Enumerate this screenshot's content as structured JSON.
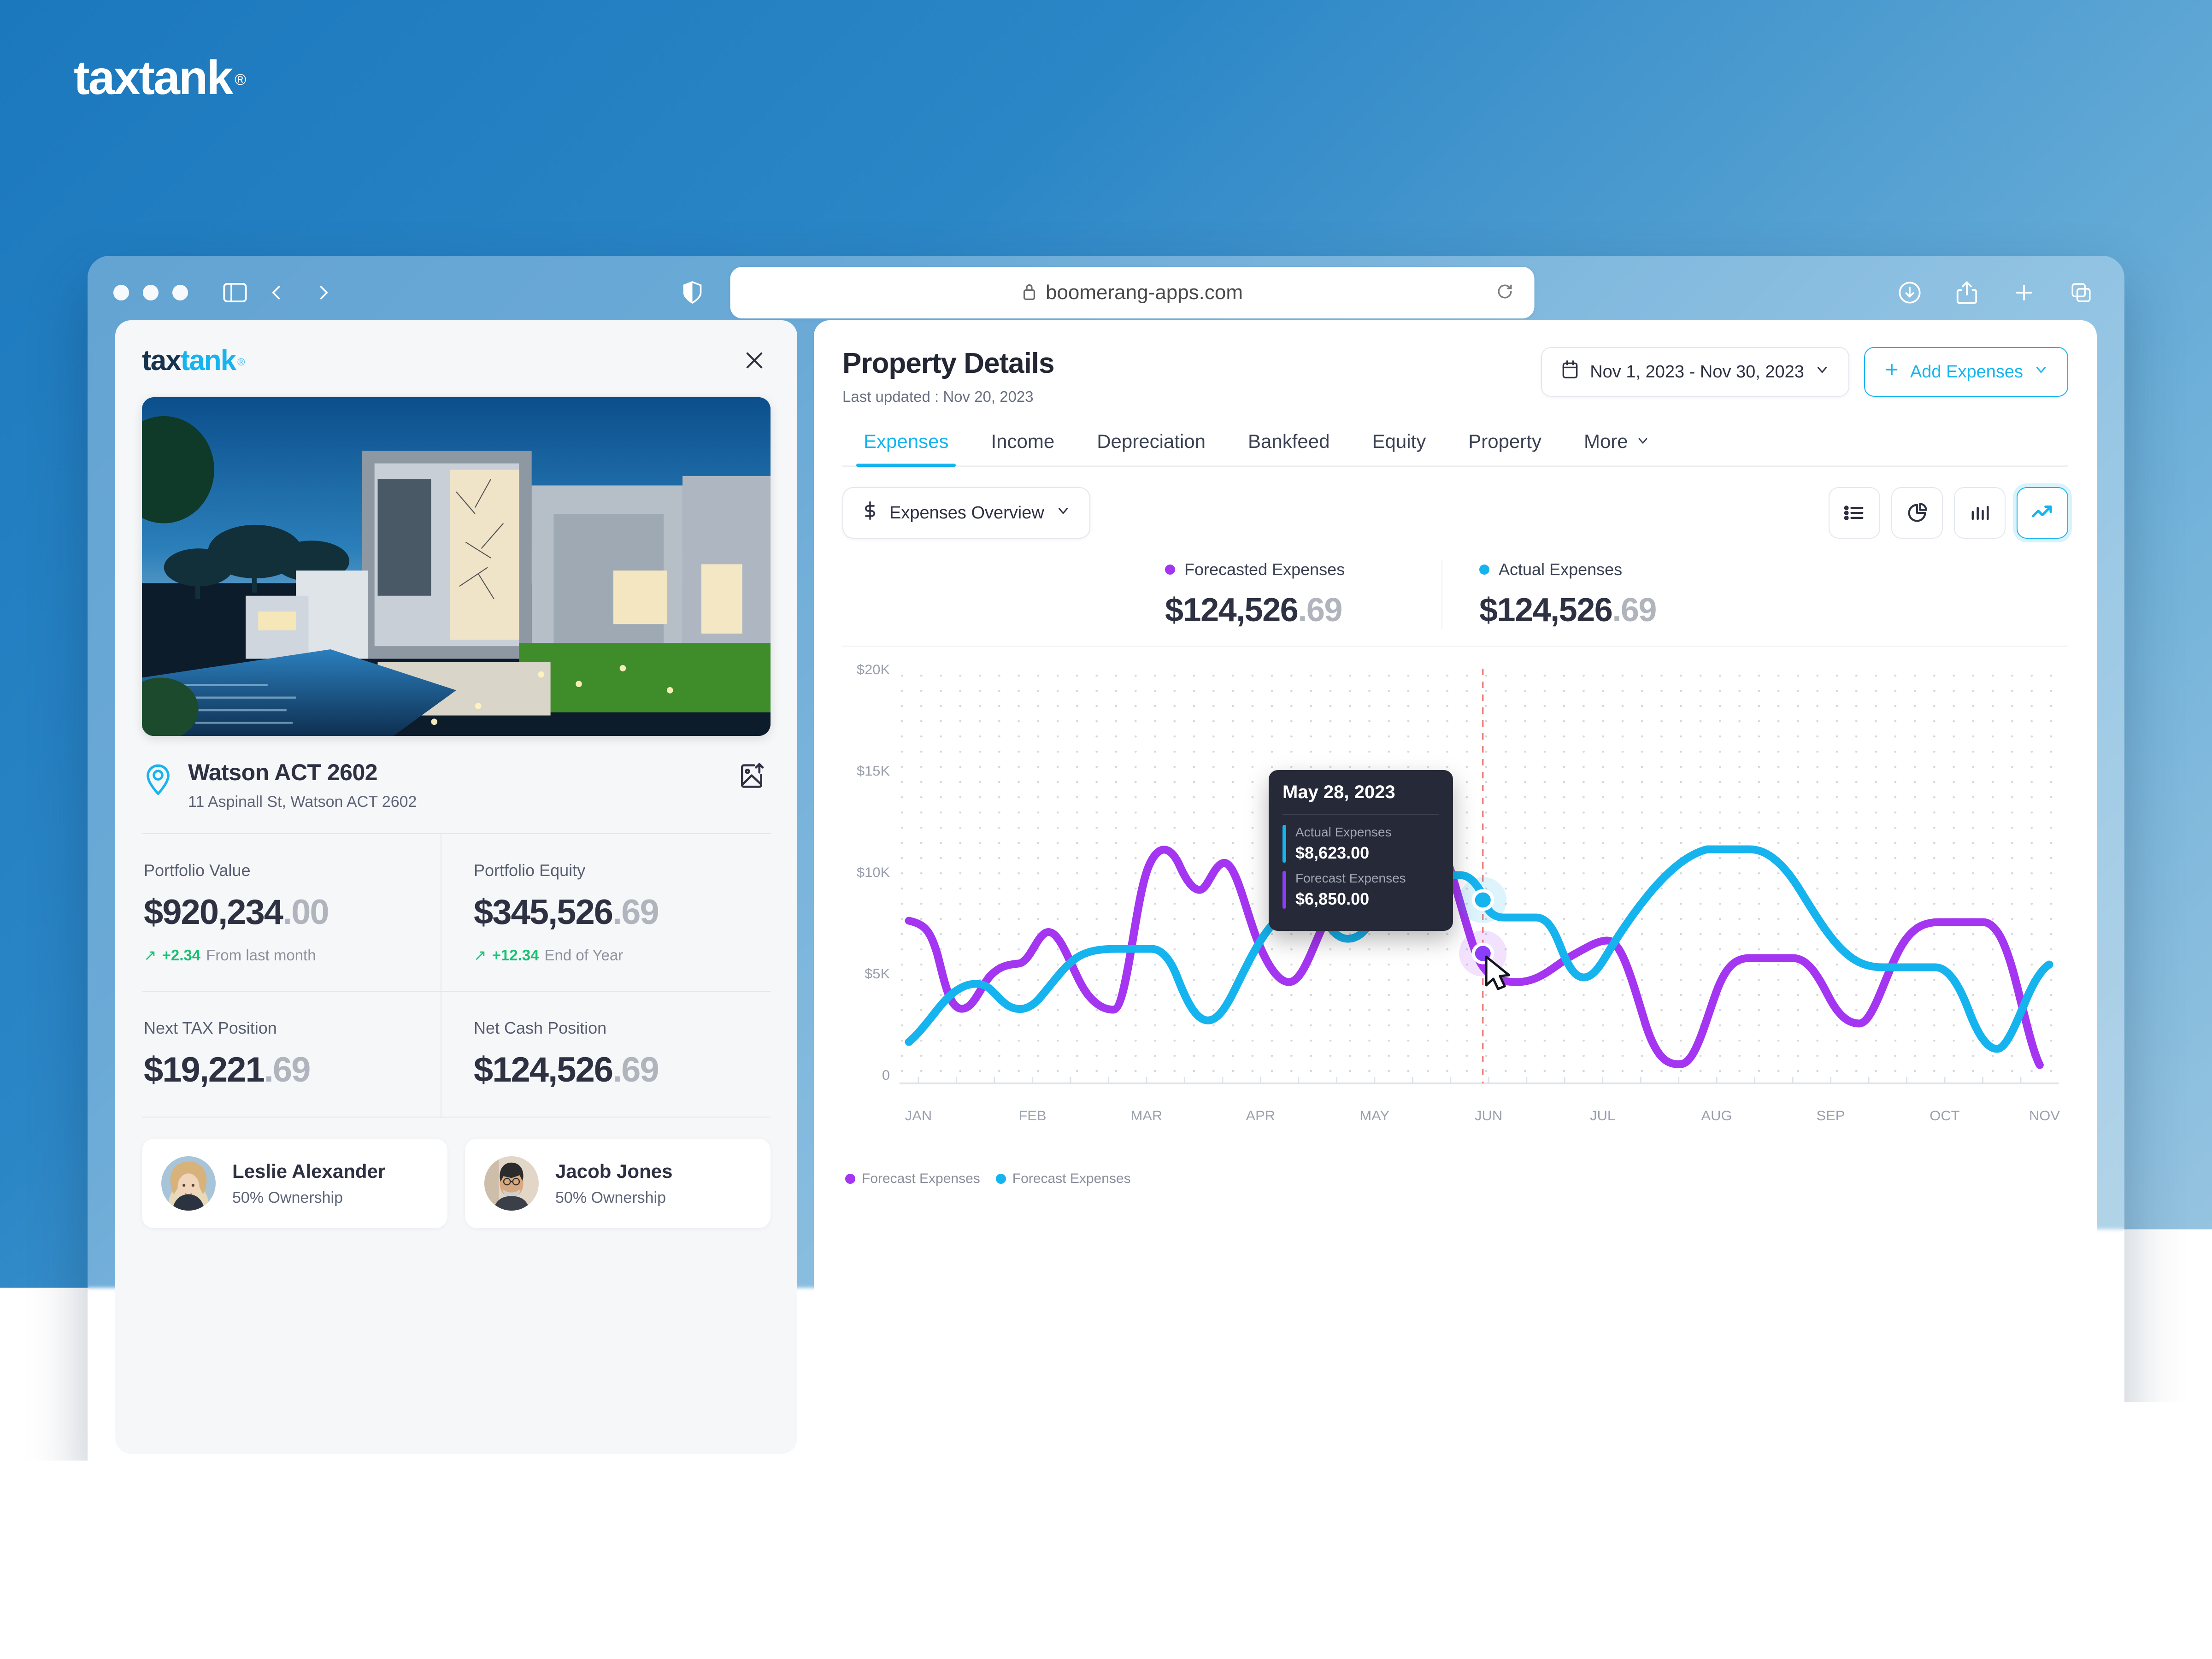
{
  "brand": {
    "name_part1": "tax",
    "name_part2": "tank",
    "registered": "®"
  },
  "browser": {
    "url": "boomerang-apps.com",
    "icons": {
      "sidebar": "sidebar-icon",
      "back": "back-icon",
      "forward": "forward-icon",
      "shield": "shield-icon",
      "lock": "lock-icon",
      "reload": "reload-icon",
      "download": "download-icon",
      "share": "share-icon",
      "new_tab": "plus-icon",
      "tabs": "copy-tabs-icon"
    }
  },
  "sidebar": {
    "logo_tax": "tax",
    "logo_tank": "tank",
    "logo_reg": "®",
    "close_label": "✕",
    "property": {
      "title": "Watson ACT 2602",
      "address": "11 Aspinall St, Watson ACT 2602"
    },
    "stats": [
      {
        "label": "Portfolio Value",
        "value": "$920,234",
        "cents": ".00",
        "delta": "+2.34",
        "delta_note": "From last month"
      },
      {
        "label": "Portfolio Equity",
        "value": "$345,526",
        "cents": ".69",
        "delta": "+12.34",
        "delta_note": "End of Year"
      },
      {
        "label": "Next TAX Position",
        "value": "$19,221",
        "cents": ".69",
        "delta": "",
        "delta_note": ""
      },
      {
        "label": "Net Cash Position",
        "value": "$124,526",
        "cents": ".69",
        "delta": "",
        "delta_note": ""
      }
    ],
    "owners": [
      {
        "name": "Leslie Alexander",
        "ownership": "50% Ownership"
      },
      {
        "name": "Jacob Jones",
        "ownership": "50% Ownership"
      }
    ]
  },
  "main": {
    "title": "Property Details",
    "last_updated": "Last updated : Nov 20, 2023",
    "date_range": "Nov 1, 2023 - Nov 30, 2023",
    "add_expenses": "Add Expenses",
    "tabs": [
      {
        "label": "Expenses",
        "active": true
      },
      {
        "label": "Income",
        "active": false
      },
      {
        "label": "Depreciation",
        "active": false
      },
      {
        "label": "Bankfeed",
        "active": false
      },
      {
        "label": "Equity",
        "active": false
      },
      {
        "label": "Property",
        "active": false
      },
      {
        "label": "More",
        "active": false
      }
    ],
    "overview_select": "Expenses Overview",
    "view_toggles": [
      {
        "name": "list-view-icon",
        "active": false
      },
      {
        "name": "pie-chart-view-icon",
        "active": false
      },
      {
        "name": "bar-chart-view-icon",
        "active": false
      },
      {
        "name": "trend-line-view-icon",
        "active": true
      }
    ],
    "summary": [
      {
        "legend": "Forecasted Expenses",
        "color": "#a435f0",
        "value": "$124,526",
        "cents": ".69"
      },
      {
        "legend": "Actual Expenses",
        "color": "#15b4ef",
        "value": "$124,526",
        "cents": ".69"
      }
    ],
    "tooltip": {
      "date": "May 28, 2023",
      "rows": [
        {
          "label": "Actual Expenses",
          "value": "$8,623.00",
          "color": "#15b4ef"
        },
        {
          "label": "Forecast Expenses",
          "value": "$6,850.00",
          "color": "#8b3dfa"
        }
      ]
    },
    "chart_legend": [
      {
        "label": "Forecast Expenses",
        "color": "#a435f0"
      },
      {
        "label": "Forecast Expenses",
        "color": "#15b4ef"
      }
    ]
  },
  "chart_data": {
    "type": "line",
    "title": "",
    "xlabel": "",
    "ylabel": "",
    "ylim": [
      0,
      20000
    ],
    "y_ticks": [
      0,
      5000,
      10000,
      15000,
      20000
    ],
    "y_tick_labels": [
      "0",
      "$5K",
      "$10K",
      "$15K",
      "$20K"
    ],
    "grid": "dotted",
    "legend_position": "bottom-left",
    "categories": [
      "JAN",
      "FEB",
      "MAR",
      "APR",
      "MAY",
      "JUN",
      "JUL",
      "AUG",
      "SEP",
      "OCT",
      "NOV"
    ],
    "x_tick_labels": [
      "JAN",
      "FEB",
      "MAR",
      "APR",
      "MAY",
      "JUN",
      "JUL",
      "AUG",
      "SEP",
      "OCT",
      "NOV"
    ],
    "highlight": {
      "x_label": "MAY",
      "date": "May 28, 2023",
      "actual": 8623,
      "forecast": 6850
    },
    "series": [
      {
        "name": "Forecast Expenses",
        "color": "#a435f0",
        "values": [
          8800,
          4200,
          6500,
          7300,
          6300,
          9800,
          7500,
          5900,
          8200,
          7800,
          5600
        ]
      },
      {
        "name": "Actual Expenses",
        "color": "#15b4ef",
        "values": [
          3600,
          5200,
          7000,
          6400,
          8700,
          8500,
          7400,
          9600,
          8300,
          8300,
          6400
        ]
      }
    ]
  }
}
